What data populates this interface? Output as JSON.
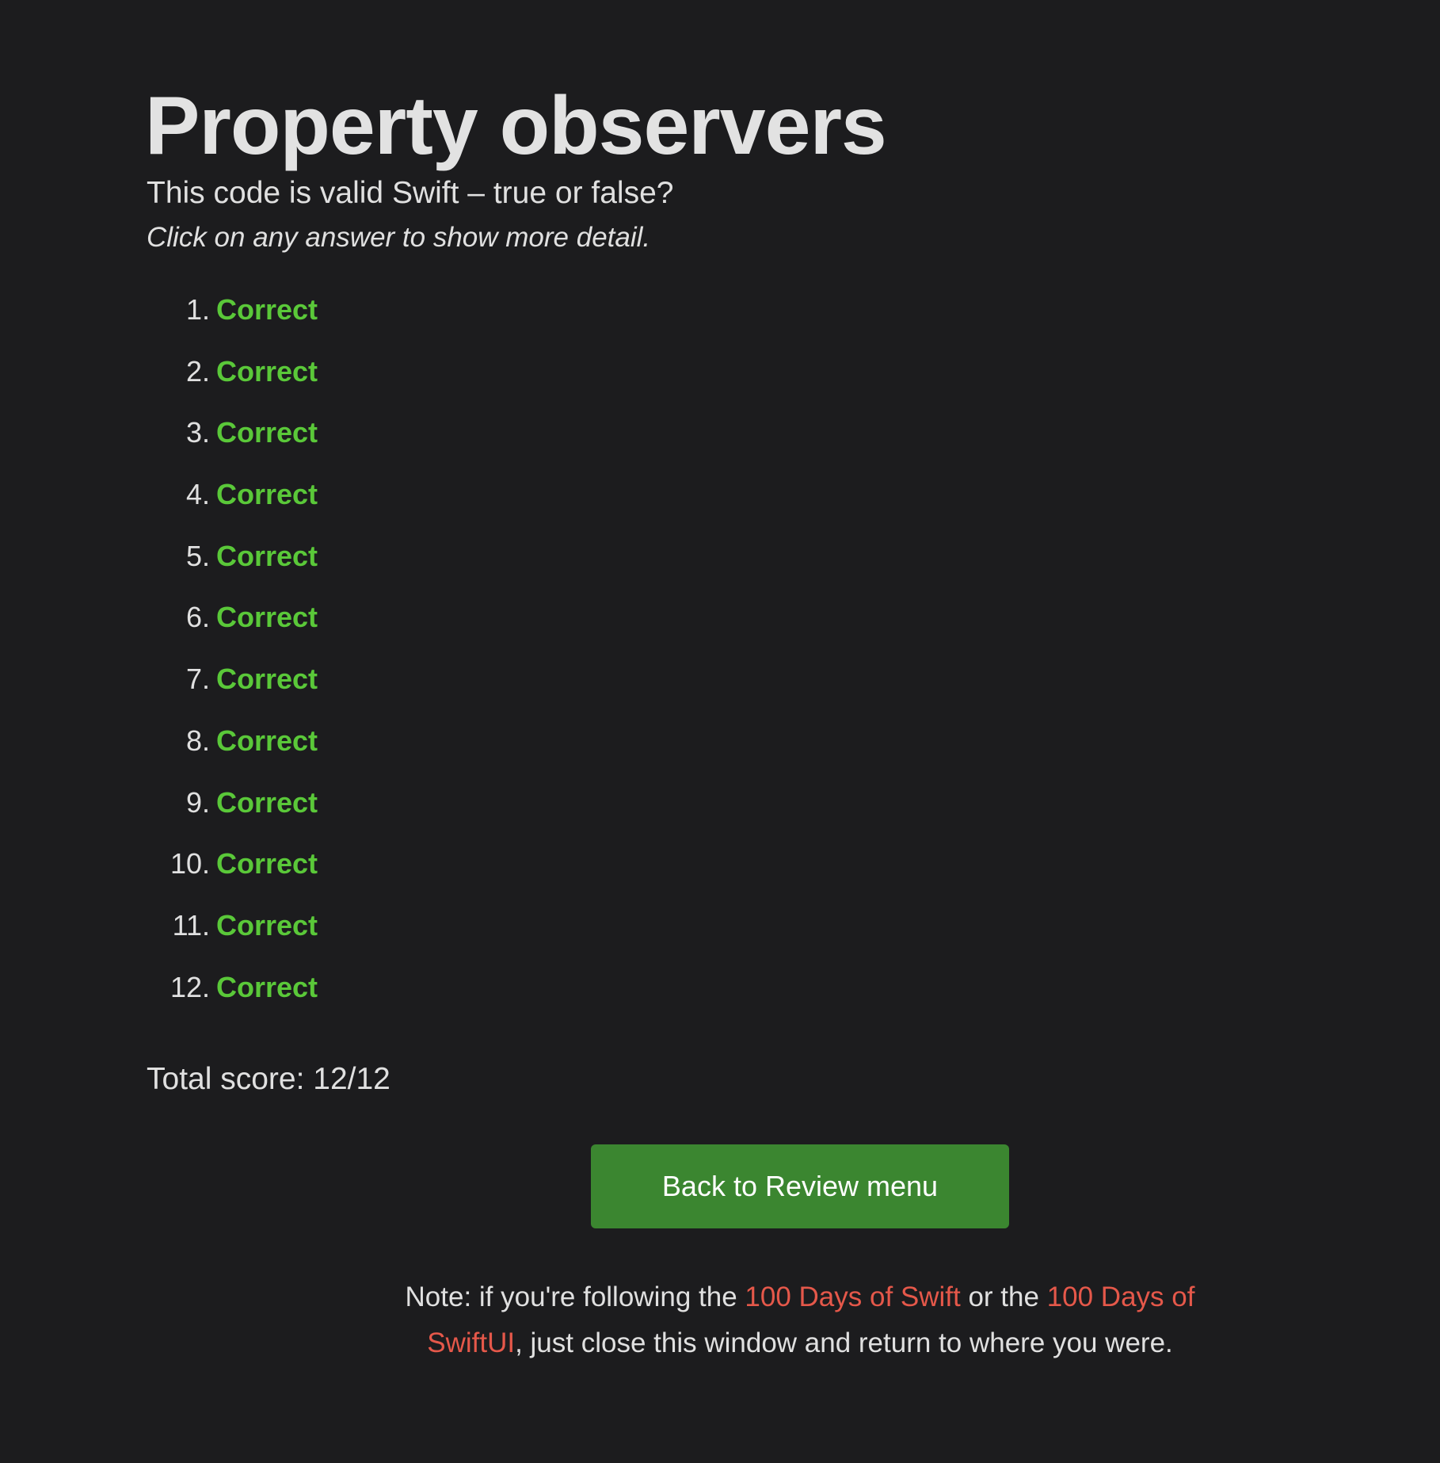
{
  "title": "Property observers",
  "subtitle": "This code is valid Swift – true or false?",
  "hint": "Click on any answer to show more detail.",
  "answers": [
    {
      "num": "1.",
      "label": "Correct"
    },
    {
      "num": "2.",
      "label": "Correct"
    },
    {
      "num": "3.",
      "label": "Correct"
    },
    {
      "num": "4.",
      "label": "Correct"
    },
    {
      "num": "5.",
      "label": "Correct"
    },
    {
      "num": "6.",
      "label": "Correct"
    },
    {
      "num": "7.",
      "label": "Correct"
    },
    {
      "num": "8.",
      "label": "Correct"
    },
    {
      "num": "9.",
      "label": "Correct"
    },
    {
      "num": "10.",
      "label": "Correct"
    },
    {
      "num": "11.",
      "label": "Correct"
    },
    {
      "num": "12.",
      "label": "Correct"
    }
  ],
  "score": "Total score: 12/12",
  "back_button": "Back to Review menu",
  "note": {
    "part1": "Note: if you're following the ",
    "link1": "100 Days of Swift",
    "part2": " or the ",
    "link2": "100 Days of SwiftUI",
    "part3": ", just close this window and return to where you were."
  },
  "colors": {
    "correct": "#5ac839",
    "button": "#3b8630",
    "link": "#e5584a",
    "background": "#1c1c1e"
  }
}
